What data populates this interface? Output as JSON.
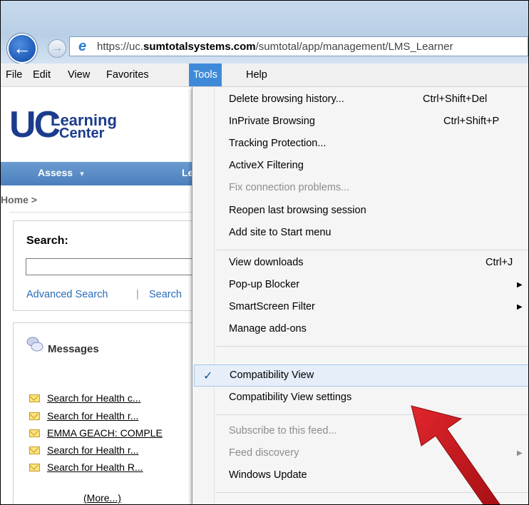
{
  "browser": {
    "url_prefix": "https://uc.",
    "url_domain": "sumtotalsystems.com",
    "url_path": "/sumtotal/app/management/LMS_Learner"
  },
  "menubar": {
    "items": [
      "File",
      "Edit",
      "View",
      "Favorites",
      "Tools",
      "Help"
    ],
    "active": "Tools"
  },
  "page": {
    "logo_uc": "UC",
    "logo_line1": "Learning",
    "logo_line2": "Center",
    "nav_assess": "Assess",
    "nav_more": "Le",
    "breadcrumb": "Home >",
    "search_label": "Search:",
    "search_value": "",
    "advanced_search": "Advanced Search",
    "separator": "|",
    "search_link2": "Search",
    "messages_title": "Messages",
    "messages": [
      "Search for Health c...",
      "Search for Health r...",
      "EMMA GEACH: COMPLE",
      "Search for Health r...",
      "Search for Health R..."
    ],
    "more_link": "(More...)"
  },
  "tools_menu": {
    "groups": [
      [
        {
          "label": "Delete browsing history...",
          "shortcut": "Ctrl+Shift+Del"
        },
        {
          "label": "InPrivate Browsing",
          "shortcut": "Ctrl+Shift+P"
        },
        {
          "label": "Tracking Protection..."
        },
        {
          "label": "ActiveX Filtering"
        },
        {
          "label": "Fix connection problems...",
          "disabled": true
        },
        {
          "label": "Reopen last browsing session"
        },
        {
          "label": "Add site to Start menu"
        }
      ],
      [
        {
          "label": "View downloads",
          "shortcut": "Ctrl+J"
        },
        {
          "label": "Pop-up Blocker",
          "submenu": true
        },
        {
          "label": "SmartScreen Filter",
          "submenu": true
        },
        {
          "label": "Manage add-ons"
        }
      ],
      [
        {
          "label": "Compatibility View",
          "checked": true
        },
        {
          "label": "Compatibility View settings"
        }
      ],
      [
        {
          "label": "Subscribe to this feed...",
          "disabled": true
        },
        {
          "label": "Feed discovery",
          "disabled": true,
          "submenu": true
        },
        {
          "label": "Windows Update"
        }
      ]
    ],
    "check_glyph": "✓",
    "submenu_glyph": "▶"
  },
  "colors": {
    "menu_highlight": "#3f8ad8",
    "arrow": "#c8161d",
    "nav_blue": "#4b7fbd",
    "logo_blue": "#1b3c8c"
  }
}
